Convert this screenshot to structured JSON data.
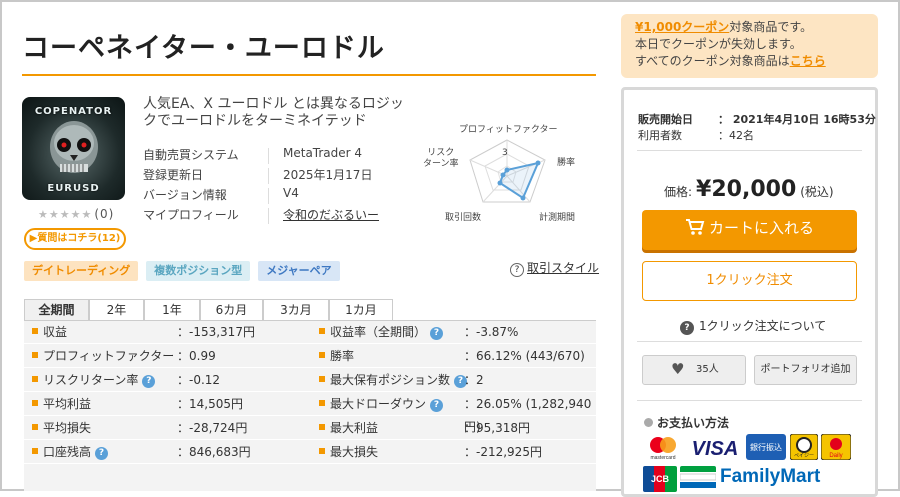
{
  "product": {
    "title": "コーペネイター・ユーロドル",
    "logo_top": "COPENATOR",
    "logo_bottom": "EURUSD",
    "rating_stars": "★★★★★",
    "rating_count": "(0)",
    "qa_button": "▶質問はコチラ(12)",
    "description": "人気EA、X ユーロドル とは異なるロジックでユーロドルをターミネイテッド"
  },
  "info": [
    {
      "label": "自動売買システム",
      "value": "MetaTrader 4"
    },
    {
      "label": "登録更新日",
      "value": "2025年1月17日"
    },
    {
      "label": "バージョン情報",
      "value": "V4"
    },
    {
      "label": "マイプロフィール",
      "value": "令和のだぶるいー"
    }
  ],
  "radar": {
    "labels": {
      "profit_factor": "プロフィットファクター",
      "risk_return": "リスク\nターン率",
      "win_rate": "勝率",
      "trades": "取引回数",
      "period": "計測期間"
    },
    "scale_label": "3",
    "accent": "#5aa0d8"
  },
  "tags": [
    "デイトレーディング",
    "複数ポジション型",
    "メジャーペア"
  ],
  "style_link": "取引スタイル",
  "tabs": [
    "全期間",
    "2年",
    "1年",
    "6カ月",
    "3カ月",
    "1カ月"
  ],
  "stats": [
    {
      "l_label": "収益",
      "l_help": false,
      "l_value": "：-153,317円",
      "r_label": "収益率（全期間）",
      "r_help": true,
      "r_value": "：-3.87%"
    },
    {
      "l_label": "プロフィットファクター",
      "l_help": false,
      "l_value": "：0.99",
      "r_label": "勝率",
      "r_help": false,
      "r_value": "：66.12% (443/670)"
    },
    {
      "l_label": "リスクリターン率",
      "l_help": true,
      "l_value": "：-0.12",
      "r_label": "最大保有ポジション数",
      "r_help": true,
      "r_value": "：2"
    },
    {
      "l_label": "平均利益",
      "l_help": false,
      "l_value": "：14,505円",
      "r_label": "最大ドローダウン",
      "r_help": true,
      "r_value": "：26.05% (1,282,940円)"
    },
    {
      "l_label": "平均損失",
      "l_help": false,
      "l_value": "：-28,724円",
      "r_label": "最大利益",
      "r_help": false,
      "r_value": "：95,318円"
    },
    {
      "l_label": "口座残高",
      "l_help": true,
      "l_value": "：846,683円",
      "r_label": "最大損失",
      "r_help": false,
      "r_value": "：-212,925円"
    }
  ],
  "coupon": {
    "amount_link": "¥1,000クーポン",
    "line1_rest": "対象商品です。",
    "line2": "本日でクーポンが失効します。",
    "line3_prefix": "すべてのクーポン対象商品は",
    "line3_link": "こちら"
  },
  "sale": {
    "start_label": "販売開始日",
    "start_value": "： 2021年4月10日 16時53分",
    "users_label": "利用者数",
    "users_value": "：42名",
    "price_label": "価格:",
    "price_value": "¥20,000",
    "tax_note": "(税込)",
    "cart_button": "カートに入れる",
    "oneclick_button": "1クリック注文",
    "oneclick_about": "1クリック注文について",
    "favorite_count": "35人",
    "portfolio_button": "ポートフォリオ追加",
    "payment_title": "お支払い方法",
    "payments": [
      "mastercard",
      "VISA",
      "銀行振込",
      "ペイジー",
      "Daily",
      "JCB",
      "FamilyMart"
    ]
  },
  "colors": {
    "accent": "#f39800",
    "coupon_bg": "#fde5c3"
  }
}
